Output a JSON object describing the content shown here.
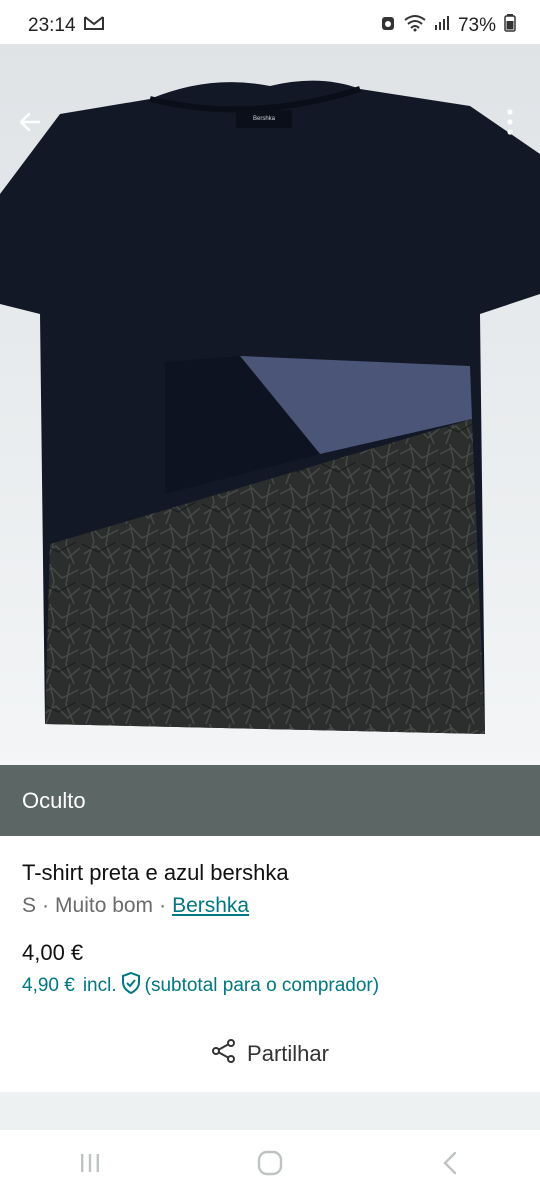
{
  "status": {
    "time": "23:14",
    "battery": "73%",
    "icons": [
      "gmail-icon",
      "alarm-icon",
      "wifi-icon",
      "signal-icon",
      "battery-icon"
    ]
  },
  "photo": {
    "alt_brand_label": "Bershka",
    "icons": {
      "back": "arrow-left-icon",
      "more": "more-vertical-icon"
    }
  },
  "banner": {
    "label": "Oculto"
  },
  "item": {
    "title": "T-shirt preta e azul bershka",
    "size": "S",
    "separator": "·",
    "condition": "Muito bom",
    "brand": "Bershka",
    "price": "4,00 €",
    "price_incl_amount": "4,90 €",
    "price_incl_label": "incl.",
    "price_incl_note": "(subtotal para o comprador)"
  },
  "share": {
    "label": "Partilhar",
    "icon": "share-icon"
  },
  "colors": {
    "accent": "#007782",
    "banner": "#5b6665",
    "muted": "#6b6b6b"
  },
  "nav": {
    "icons": [
      "recents-icon",
      "home-icon",
      "back-icon"
    ]
  }
}
